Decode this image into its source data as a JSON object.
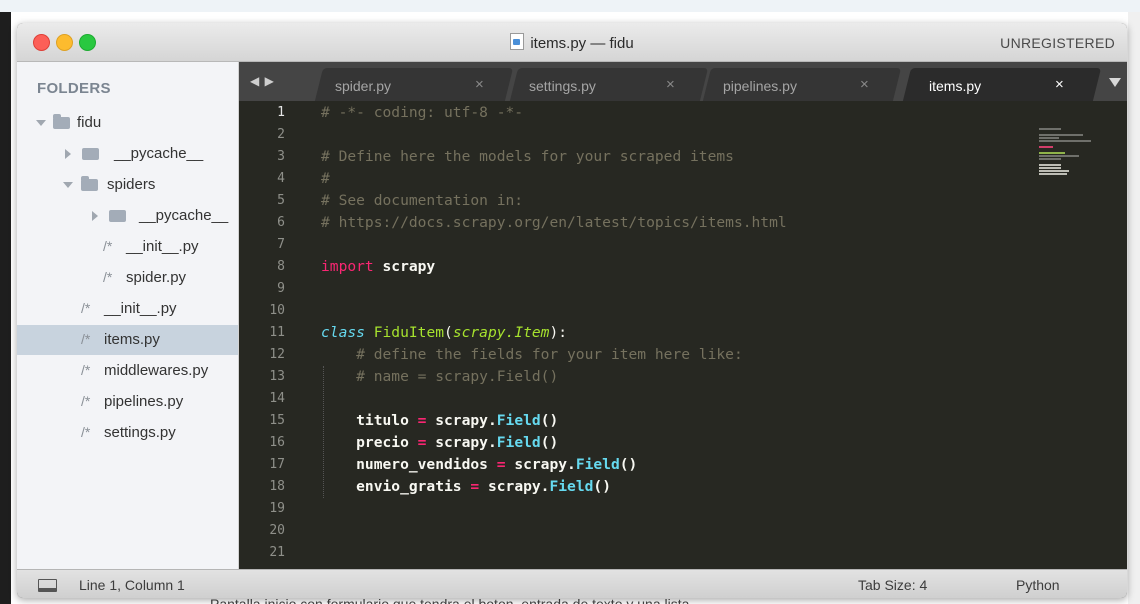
{
  "background": {
    "bottom_text": "Pantalla inicio con formulario que tendra el boton, entrada de texto y una lista",
    "bullet": "-"
  },
  "window": {
    "title": "items.py — fidu",
    "registration": "UNREGISTERED",
    "file_icon": "python-file-icon"
  },
  "sidebar": {
    "header": "FOLDERS",
    "tree": [
      {
        "label": "fidu",
        "kind": "folder",
        "expanded": true
      },
      {
        "label": "__pycache__",
        "kind": "folder",
        "expanded": false
      },
      {
        "label": "spiders",
        "kind": "folder",
        "expanded": true
      },
      {
        "label": "__pycache__",
        "kind": "folder",
        "expanded": false
      },
      {
        "label": "__init__.py",
        "kind": "file",
        "mark": "/*"
      },
      {
        "label": "spider.py",
        "kind": "file",
        "mark": "/*"
      },
      {
        "label": "__init__.py",
        "kind": "file",
        "mark": "/*"
      },
      {
        "label": "items.py",
        "kind": "file",
        "mark": "/*",
        "selected": true
      },
      {
        "label": "middlewares.py",
        "kind": "file",
        "mark": "/*"
      },
      {
        "label": "pipelines.py",
        "kind": "file",
        "mark": "/*"
      },
      {
        "label": "settings.py",
        "kind": "file",
        "mark": "/*"
      }
    ]
  },
  "tabs": {
    "nav": "◀ ▶",
    "items": [
      {
        "label": "spider.py",
        "close": "×"
      },
      {
        "label": "settings.py",
        "close": "×"
      },
      {
        "label": "pipelines.py",
        "close": "×"
      },
      {
        "label": "items.py",
        "close": "×",
        "active": true
      }
    ],
    "dropdown_icon": "chevron-down-icon"
  },
  "editor": {
    "line_numbers": [
      "1",
      "2",
      "3",
      "4",
      "5",
      "6",
      "7",
      "8",
      "9",
      "10",
      "11",
      "12",
      "13",
      "14",
      "15",
      "16",
      "17",
      "18",
      "19",
      "20",
      "21"
    ],
    "current_line": 1,
    "lines": [
      "# -*- coding: utf-8 -*-",
      "",
      "# Define here the models for your scraped items",
      "#",
      "# See documentation in:",
      "# https://docs.scrapy.org/en/latest/topics/items.html",
      "",
      "import scrapy",
      "",
      "",
      "class FiduItem(scrapy.Item):",
      "    # define the fields for your item here like:",
      "    # name = scrapy.Field()",
      "",
      "    titulo = scrapy.Field()",
      "    precio = scrapy.Field()",
      "    numero_vendidos = scrapy.Field()",
      "    envio_gratis = scrapy.Field()",
      "",
      "",
      ""
    ],
    "tokens": {
      "l1": "# -*- coding: utf-8 -*-",
      "l3": "# Define here the models for your scraped items",
      "l4": "#",
      "l5": "# See documentation in:",
      "l6": "# https://docs.scrapy.org/en/latest/topics/items.html",
      "l8_kw": "import",
      "l8_mod": " scrapy",
      "l11_kw": "class",
      "l11_name": " FiduItem",
      "l11_open": "(",
      "l11_base": "scrapy.Item",
      "l11_close": "):",
      "l12": "    # define the fields for your item here like:",
      "l13": "    # name = scrapy.Field()",
      "l15_a": "    titulo ",
      "l16_a": "    precio ",
      "l17_a": "    numero_vendidos ",
      "l18_a": "    envio_gratis ",
      "eq": "=",
      "scrapy_dot": " scrapy.",
      "field": "Field",
      "parens": "()"
    },
    "colors": {
      "background": "#272822",
      "comment": "#75715e",
      "keyword": "#f92672",
      "class_name": "#a6e22e",
      "builtin": "#66d9ef",
      "text": "#f8f8f2"
    }
  },
  "statusbar": {
    "position": "Line 1, Column 1",
    "tab_size": "Tab Size: 4",
    "syntax": "Python"
  }
}
